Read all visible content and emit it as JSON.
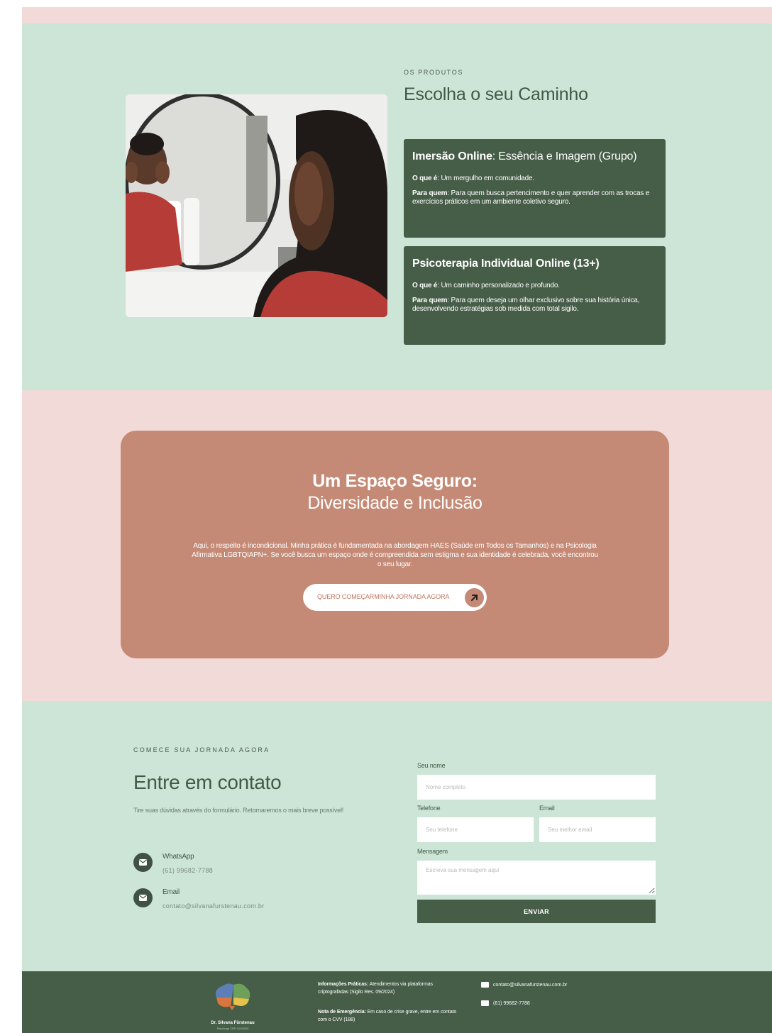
{
  "products": {
    "eyebrow": "OS PRODUTOS",
    "title": "Escolha o seu Caminho",
    "cards": [
      {
        "title_bold": "Imersão Online",
        "title_rest": ": Essência e Imagem (Grupo)",
        "what_label": "O que é",
        "what_text": ": Um mergulho em comunidade.",
        "who_label": "Para quem",
        "who_text": ": Para quem busca pertencimento e quer aprender com as trocas e exercícios práticos em um ambiente coletivo seguro."
      },
      {
        "title_bold": "Psicoterapia Individual Online (13+)",
        "title_rest": "",
        "what_label": "O que é",
        "what_text": ": Um caminho personalizado e profundo.",
        "who_label": "Para quem",
        "who_text": ": Para quem deseja um olhar exclusivo sobre sua história única, desenvolvendo estratégias sob medida com total sigilo."
      }
    ]
  },
  "safe_space": {
    "title": "Um Espaço Seguro:",
    "subtitle": "Diversidade e Inclusão",
    "body": "Aqui, o respeito é incondicional. Minha prática é fundamentada na abordagem HAES (Saúde em Todos os Tamanhos) e na Psicologia Afirmativa LGBTQIAPN+. Se você busca um espaço onde é compreendida sem estigma e sua identidade é celebrada, você encontrou o seu lugar.",
    "cta_label": "QUERO COMEÇARMINHA JORNADA AGORA",
    "cta_icon": "arrow-up-right-icon"
  },
  "contact": {
    "eyebrow": "COMECE SUA JORNADA AGORA",
    "title": "Entre em contato",
    "description": "Tire suas dúvidas através do formulário. Retornaremos o mais breve possível!",
    "channels": [
      {
        "label": "WhatsApp",
        "value": "(61) 99682-7788",
        "icon": "envelope-icon"
      },
      {
        "label": "Email",
        "value": "contato@silvanafurstenau.com.br",
        "icon": "envelope-icon"
      }
    ],
    "form": {
      "name_label": "Seu nome",
      "name_placeholder": "Nome completo",
      "phone_label": "Telefone",
      "phone_placeholder": "Seu telefone",
      "email_label": "Email",
      "email_placeholder": "Seu melhor email",
      "message_label": "Mensagem",
      "message_placeholder": "Escreva sua mensagem aqui",
      "submit_label": "ENVIAR"
    }
  },
  "footer": {
    "brand": "Dr. Silvana Fürstenau",
    "brand_sub": "Psicóloga CRP 01/00000",
    "info_label": "Informações Práticas:",
    "info_text": " Atendimentos via plataformas criptografadas (Sigilo Res. 09/2024)",
    "emergency_label": "Nota de Emergência:",
    "emergency_text": " Em caso de crise grave, entre em contato com o CVV (188)",
    "email": "contato@silvanafurstenau.com.br",
    "phone": "(61) 99682-7788",
    "colors": {
      "brain_blue": "#5d7fb8",
      "brain_green": "#6da05a",
      "brain_orange": "#d9753e",
      "brain_yellow": "#e7c24a"
    }
  },
  "colors": {
    "mint_bg": "#cde5d7",
    "pink_bg": "#f2dad8",
    "dark_green": "#465d47",
    "terracotta": "#c48a76"
  }
}
